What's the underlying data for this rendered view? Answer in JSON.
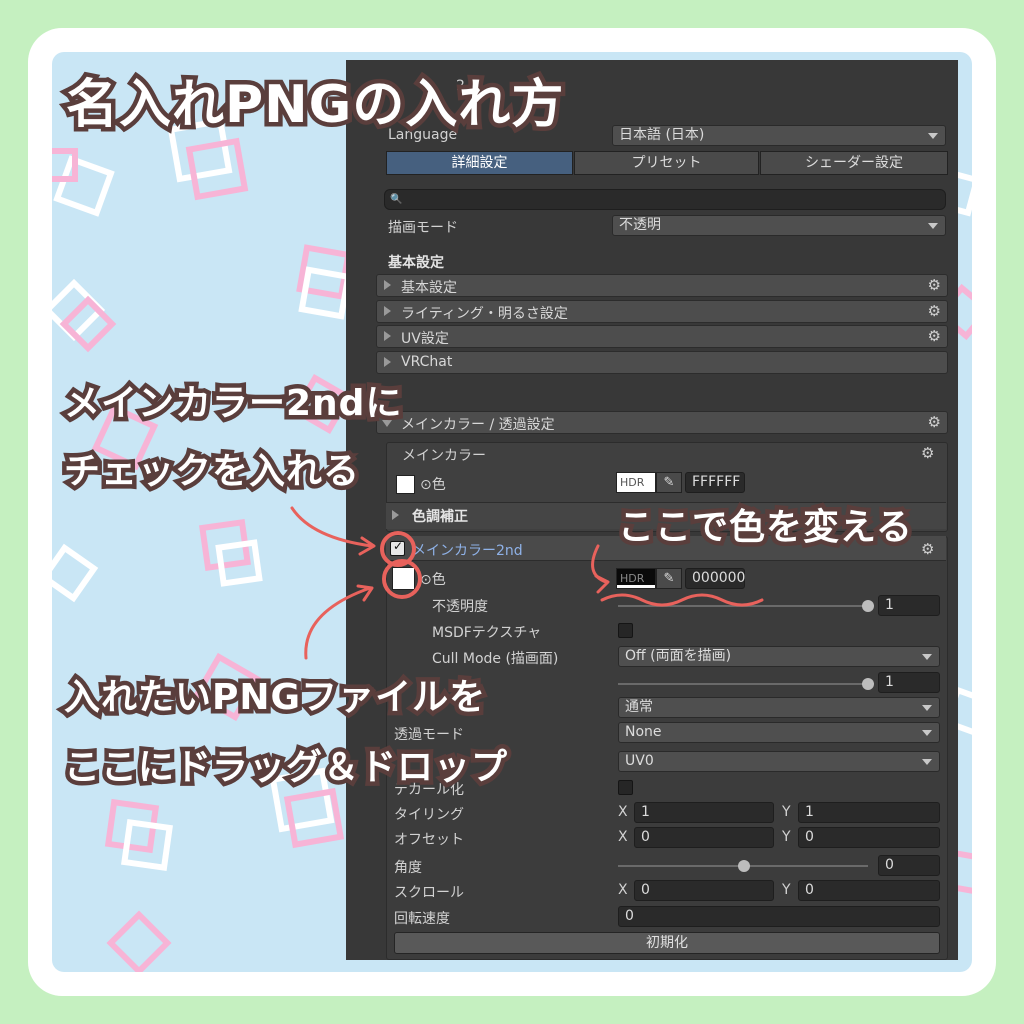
{
  "title": "名入れPNGの入れ方",
  "title_partial_behind": "2",
  "inspector": {
    "language_label": "Language",
    "language_value": "日本語 (日本)",
    "tabs": [
      "詳細設定",
      "プリセット",
      "シェーダー設定"
    ],
    "search_icon": "🔍",
    "render_mode_label": "描画モード",
    "render_mode_value": "不透明",
    "basic_settings_header": "基本設定",
    "collapsed_sections": [
      "基本設定",
      "ライティング・明るさ設定",
      "UV設定",
      "VRChat"
    ],
    "main_color_section": "メインカラー / 透過設定",
    "main_color_subsection": "メインカラー",
    "color_label": "⊙色",
    "hdr_label": "HDR",
    "main_color_hex": "FFFFFF",
    "color_correction": "色調補正",
    "main_color_2nd": "メインカラー2nd",
    "color2_hex": "000000",
    "opacity_label": "不透明度",
    "opacity_value": "1",
    "msdf_label": "MSDFテクスチャ",
    "cull_label": "Cull Mode (描画面)",
    "cull_value": "Off (両面を描画)",
    "lighting_value": "1",
    "blend_value": "通常",
    "transparency_label": "透過モード",
    "transparency_value": "None",
    "uv_value": "UV0",
    "decal_label": "デカール化",
    "tiling_label": "タイリング",
    "offset_label": "オフセット",
    "angle_label": "角度",
    "scroll_label": "スクロール",
    "rotation_label": "回転速度",
    "x_label": "X",
    "y_label": "Y",
    "tiling_x": "1",
    "tiling_y": "1",
    "offset_x": "0",
    "offset_y": "0",
    "angle_value": "0",
    "scroll_x": "0",
    "scroll_y": "0",
    "rotation_value": "0",
    "reset_button": "初期化",
    "gear_icon": "⚙",
    "eyedropper_icon": "✎"
  },
  "annotations": {
    "line1a": "メインカラー2ndに",
    "line1b": "チェックを入れる",
    "line2": "ここで色を変える",
    "line3a": "入れたいPNGファイルを",
    "line3b": "ここにドラッグ＆ドロップ"
  },
  "colors": {
    "page_bg": "#c5f0c0",
    "inner_bg": "#c9e6f5",
    "annotation_stroke": "#5a3e3c",
    "highlight_red": "#e8625c",
    "tab_active": "#46607f",
    "link_blue": "#8fb2e8"
  }
}
